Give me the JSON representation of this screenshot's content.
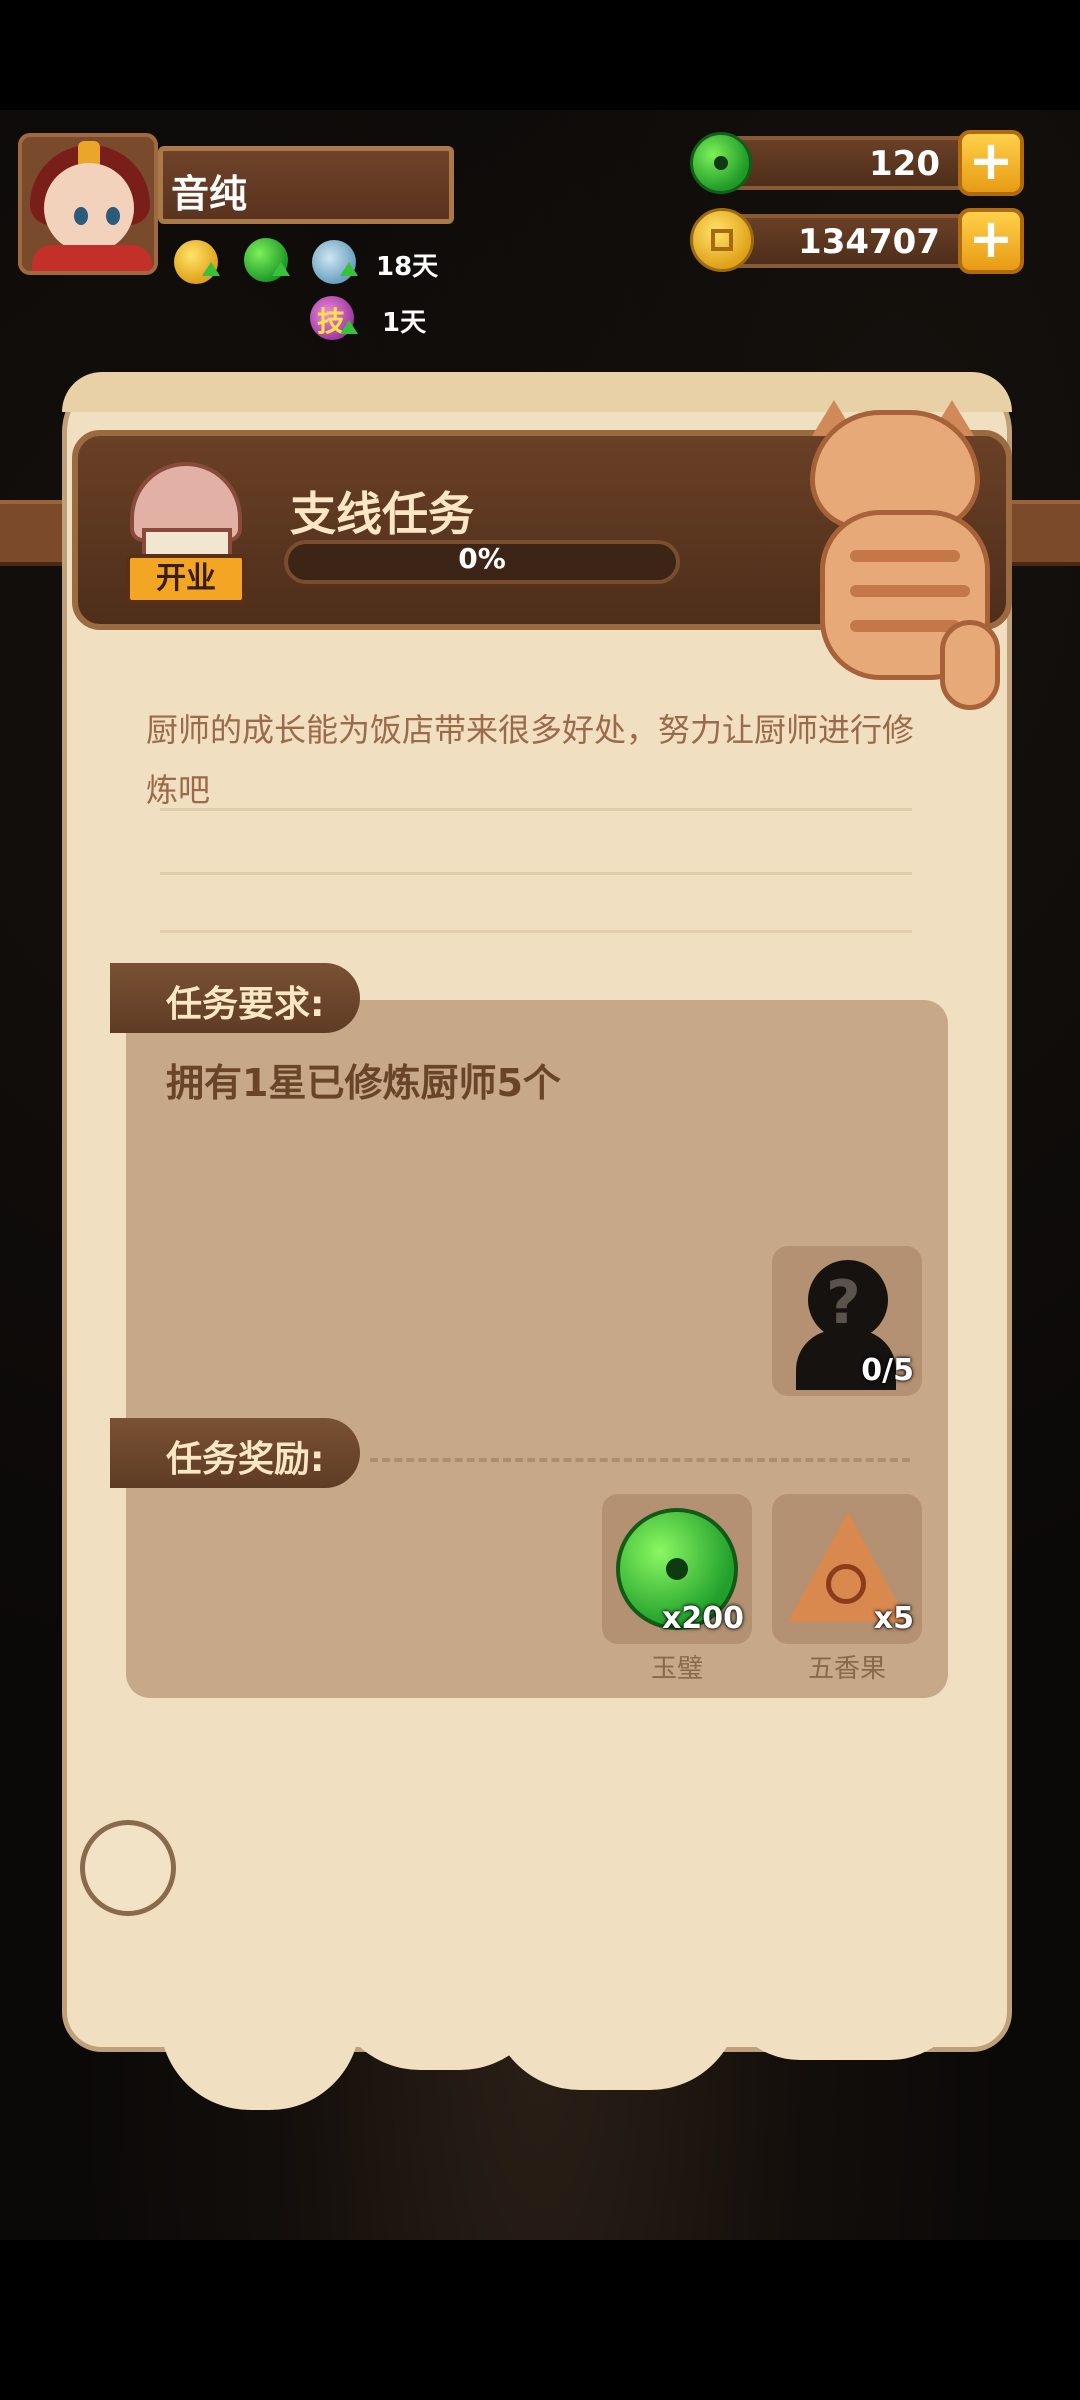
{
  "player": {
    "name": "音纯",
    "buffs": [
      {
        "icon": "gold-coin-buff-icon",
        "duration": ""
      },
      {
        "icon": "jade-buff-icon",
        "duration": ""
      },
      {
        "icon": "dish-buff-icon",
        "duration": "18天"
      },
      {
        "icon": "skill-buff-icon",
        "label": "技",
        "duration": "1天"
      }
    ]
  },
  "currency": {
    "jade": "120",
    "gold": "134707"
  },
  "task": {
    "shop_sign": "开业",
    "title": "支线任务",
    "progress_text": "0%",
    "progress_fraction": 0,
    "description": "厨师的成长能为饭店带来很多好处，努力让厨师进行修炼吧",
    "requirement_heading": "任务要求:",
    "requirement": "拥有1星已修炼厨师5个",
    "requirement_slot_count": "0/5",
    "reward_heading": "任务奖励:",
    "rewards": [
      {
        "icon": "jade-icon",
        "count": "x200",
        "name": "玉璧"
      },
      {
        "icon": "five-spice-fruit-icon",
        "count": "x5",
        "name": "五香果"
      }
    ]
  },
  "colors": {
    "parchment": "#f0dfc0",
    "wood": "#5e3c24",
    "panel": "#c7a888",
    "title_text": "#fbe7c4"
  }
}
